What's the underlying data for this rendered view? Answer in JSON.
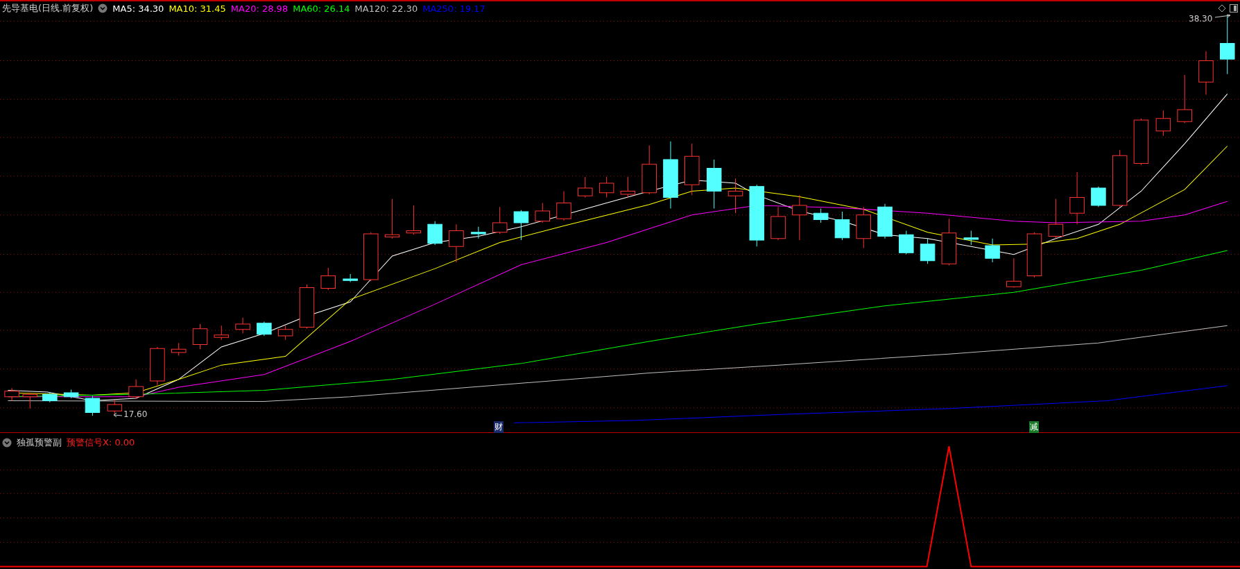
{
  "main_chart": {
    "title": "先导基电(日线.前复权)",
    "indicators": [
      {
        "label": "MA5: 34.30",
        "color": "#ffffff"
      },
      {
        "label": "MA10: 31.45",
        "color": "#ffff00"
      },
      {
        "label": "MA20: 28.98",
        "color": "#ff00ff"
      },
      {
        "label": "MA60: 26.14",
        "color": "#00ff00"
      },
      {
        "label": "MA120: 22.30",
        "color": "#c0c0c0"
      },
      {
        "label": "MA250: 19.17",
        "color": "#0000ff"
      }
    ],
    "high_label": "38.30",
    "low_label": "17.60",
    "markers": [
      {
        "text": "财",
        "color": "#1a2a6a"
      },
      {
        "text": "减",
        "color": "#1a7a2a"
      }
    ]
  },
  "sub_chart": {
    "title": "独孤预警副",
    "signal": "预警信号X: 0.00"
  }
}
